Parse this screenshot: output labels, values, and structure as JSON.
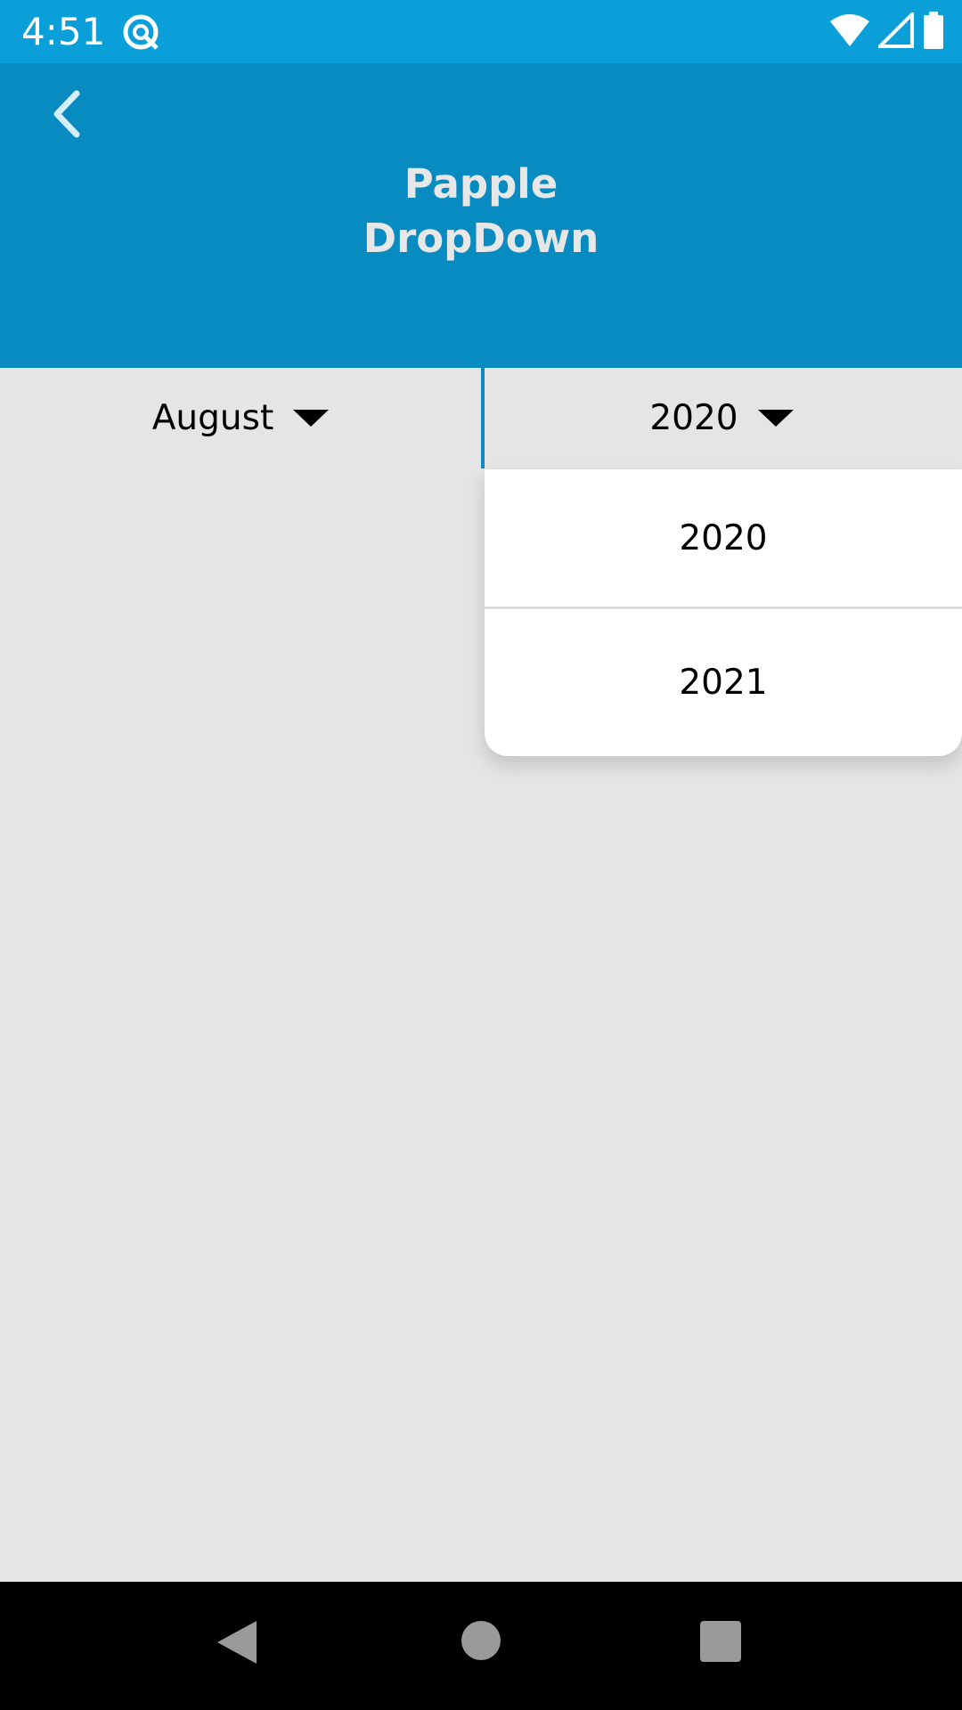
{
  "status_bar": {
    "time": "4:51",
    "icons": [
      "app-notification-icon",
      "wifi-icon",
      "signal-icon",
      "battery-icon"
    ]
  },
  "header": {
    "back_icon": "chevron-left-icon",
    "title_line1": "Papple",
    "title_line2": "DropDown",
    "background": "#088bc1"
  },
  "dropdowns": {
    "month": {
      "selected": "August"
    },
    "year": {
      "selected": "2020",
      "options": [
        "2020",
        "2021"
      ]
    }
  },
  "nav_bar": {
    "buttons": [
      "back-icon",
      "home-icon",
      "recents-icon"
    ]
  },
  "colors": {
    "status_bar": "#0a9fd8",
    "header": "#088bc1",
    "background": "#e5e5e5",
    "menu": "#ffffff"
  }
}
